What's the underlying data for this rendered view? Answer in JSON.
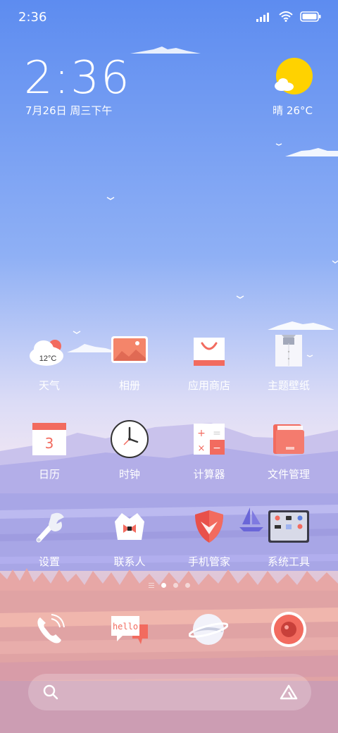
{
  "status_bar": {
    "time": "2:36"
  },
  "clock_widget": {
    "time": "2:36",
    "date": "7月26日 周三下午"
  },
  "weather_widget": {
    "text": "晴 26°C",
    "icon": "sun-cloud-icon"
  },
  "weather_app_temp": "12°C",
  "apps": [
    {
      "label": "天气",
      "icon": "weather-icon"
    },
    {
      "label": "相册",
      "icon": "gallery-icon"
    },
    {
      "label": "应用商店",
      "icon": "app-store-icon"
    },
    {
      "label": "主题壁纸",
      "icon": "themes-icon"
    },
    {
      "label": "日历",
      "icon": "calendar-icon",
      "day": "3"
    },
    {
      "label": "时钟",
      "icon": "clock-icon"
    },
    {
      "label": "计算器",
      "icon": "calculator-icon"
    },
    {
      "label": "文件管理",
      "icon": "file-manager-icon"
    },
    {
      "label": "设置",
      "icon": "settings-icon"
    },
    {
      "label": "联系人",
      "icon": "contacts-icon"
    },
    {
      "label": "手机管家",
      "icon": "security-icon"
    },
    {
      "label": "系统工具",
      "icon": "tools-folder-icon"
    }
  ],
  "page_indicator": {
    "pages": 3,
    "current": 1
  },
  "dock": [
    {
      "icon": "phone-icon"
    },
    {
      "icon": "messages-icon",
      "text": "hello"
    },
    {
      "icon": "browser-icon"
    },
    {
      "icon": "camera-icon"
    }
  ],
  "search": {
    "placeholder": ""
  },
  "colors": {
    "accent": "#f26b5f",
    "sky_top": "#5f8ff0",
    "sky_bottom": "#d7a0b4"
  }
}
